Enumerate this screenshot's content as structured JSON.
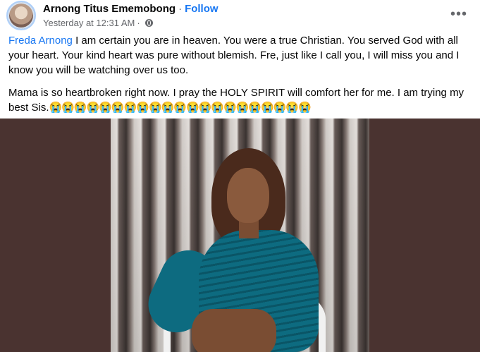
{
  "post": {
    "author_name": "Arnong Titus Ememobong",
    "separator": "·",
    "follow_label": "Follow",
    "timestamp": "Yesterday at 12:31 AM",
    "timestamp_separator": "·",
    "audience_icon": "globe-icon",
    "more_icon": "more-options-icon",
    "more_glyph": "•••",
    "mention": "Freda Arnong",
    "paragraph1_rest": " I am certain you are in heaven. You were a true Christian. You served God with all your heart. Your kind heart was pure without blemish. Fre, just like I call you, I will miss you and I know you will be watching over us too.",
    "paragraph2": "Mama is so heartbroken right now. I pray the HOLY SPIRIT will comfort her for me. I am trying my best Sis.",
    "emojis": "😭😭😭😭😭😭😭😭😭😭😭😭😭😭😭😭😭😭😭😭😭"
  },
  "colors": {
    "link": "#1877f2",
    "text": "#050505",
    "secondary": "#65676b",
    "photo_background": "#4a3330",
    "dress": "#0d6b80"
  }
}
